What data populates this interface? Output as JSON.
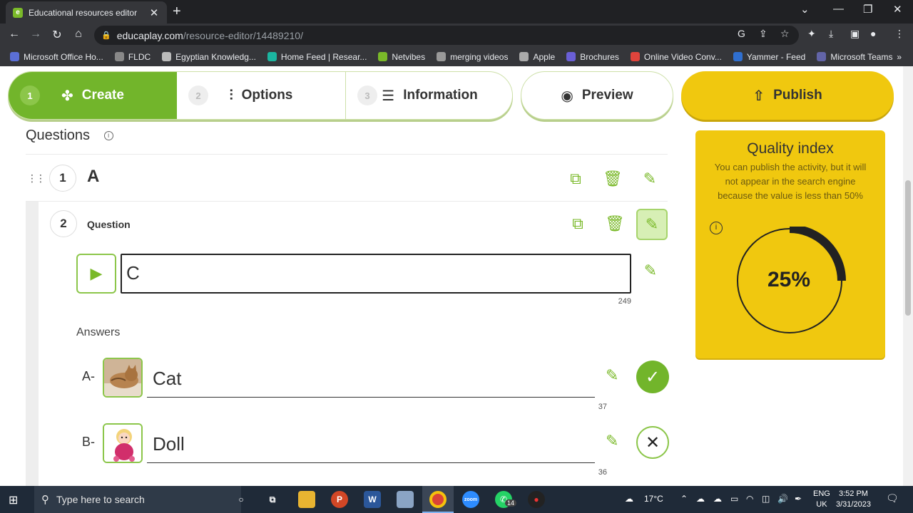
{
  "browser": {
    "tab_title": "Educational resources editor",
    "tab_favicon": "e",
    "url_host": "educaplay.com",
    "url_path": "/resource-editor/14489210/",
    "bookmarks": [
      {
        "label": "Microsoft Office Ho...",
        "color": "#5b6fd6"
      },
      {
        "label": "FLDC",
        "color": "#888888"
      },
      {
        "label": "Egyptian Knowledg...",
        "color": "#bbbbbb"
      },
      {
        "label": "Home Feed | Resear...",
        "color": "#1bb5a0"
      },
      {
        "label": "Netvibes",
        "color": "#7ab929"
      },
      {
        "label": "merging videos",
        "color": "#999999"
      },
      {
        "label": "Apple",
        "color": "#aaaaaa"
      },
      {
        "label": "Brochures",
        "color": "#6a5fd6"
      },
      {
        "label": "Online Video Conv...",
        "color": "#e0443c"
      },
      {
        "label": "Yammer - Feed",
        "color": "#2f6fd0"
      },
      {
        "label": "Microsoft Teams",
        "color": "#6264a7"
      }
    ]
  },
  "steps": [
    {
      "num": "1",
      "label": "Create",
      "icon": "puzzle-icon"
    },
    {
      "num": "2",
      "label": "Options",
      "icon": "sliders-icon"
    },
    {
      "num": "3",
      "label": "Information",
      "icon": "list-icon"
    }
  ],
  "preview_label": "Preview",
  "publish_label": "Publish",
  "questions_heading": "Questions",
  "question1": {
    "num": "1",
    "title": "A"
  },
  "question2": {
    "num": "2",
    "label": "Question",
    "text": "C",
    "char_count": "249",
    "answers_label": "Answers",
    "answers": [
      {
        "letter": "A-",
        "text": "Cat",
        "count": "37",
        "correct": true,
        "image": "cat-image"
      },
      {
        "letter": "B-",
        "text": "Doll",
        "count": "36",
        "correct": false,
        "image": "doll-image"
      }
    ]
  },
  "quality": {
    "title": "Quality index",
    "description": "You can publish the activity, but it will not appear in the search engine because the value is less than 50%",
    "percent_label": "25%",
    "percent": 25
  },
  "taskbar": {
    "search_placeholder": "Type here to search",
    "weather": "17°C",
    "lang_top": "ENG",
    "lang_bottom": "UK",
    "time": "3:52 PM",
    "date": "3/31/2023",
    "badge": "14"
  },
  "colors": {
    "brand_green": "#72b52b",
    "publish_yellow": "#f0c80f"
  }
}
